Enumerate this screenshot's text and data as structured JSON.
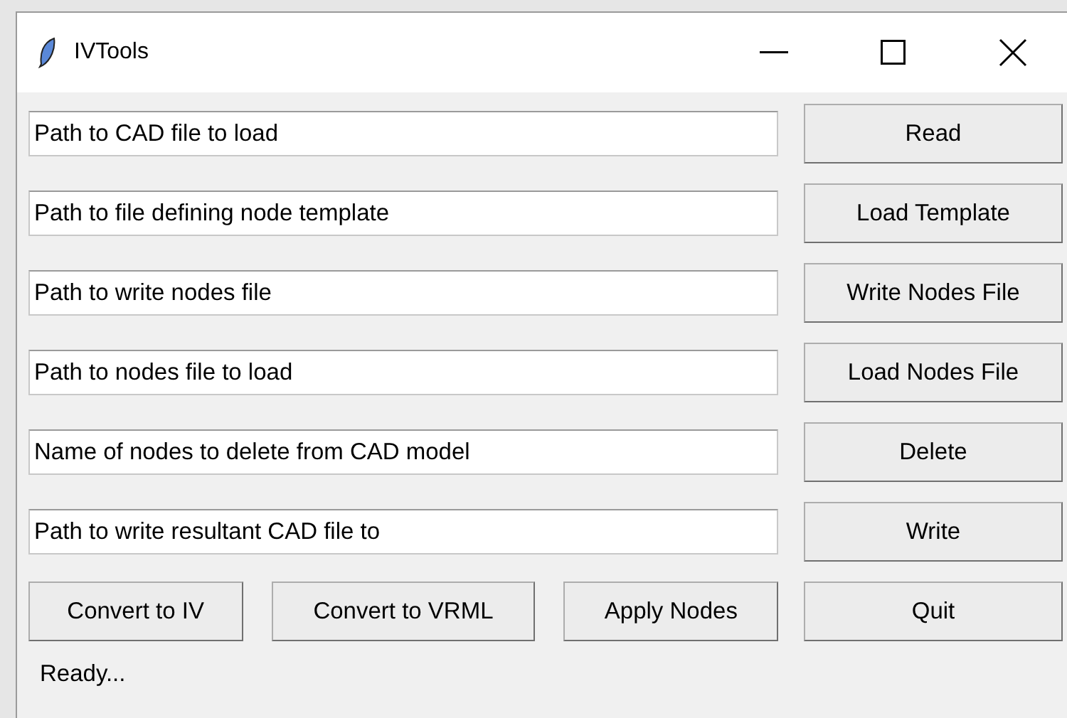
{
  "window": {
    "title": "IVTools"
  },
  "rows": [
    {
      "field": {
        "value": "Path to CAD file to load"
      },
      "button": "Read"
    },
    {
      "field": {
        "value": "Path to file defining node template"
      },
      "button": "Load Template"
    },
    {
      "field": {
        "value": "Path to write nodes file"
      },
      "button": "Write Nodes File"
    },
    {
      "field": {
        "value": "Path to nodes file to load"
      },
      "button": "Load Nodes File"
    },
    {
      "field": {
        "value": "Name of nodes to delete from CAD model"
      },
      "button": "Delete"
    },
    {
      "field": {
        "value": "Path to write resultant CAD file to"
      },
      "button": "Write"
    }
  ],
  "bottom_buttons": [
    "Convert to IV",
    "Convert to VRML",
    "Apply Nodes",
    "Quit"
  ],
  "status_bar": "Ready..."
}
